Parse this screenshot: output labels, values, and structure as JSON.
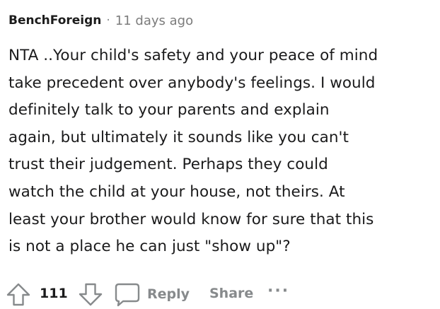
{
  "comment": {
    "author": "BenchForeign",
    "separator": "·",
    "timestamp": "11 days ago",
    "body": "NTA ..Your child's safety and your peace of mind\ntake precedent over anybody's feelings. I would\ndefinitely talk to your parents and explain\nagain, but ultimately it sounds like you can't\ntrust their judgement. Perhaps they could\nwatch the child at your house, not theirs. At\nleast your brother would know for sure that this\nis not a place he can just \"show up\"?"
  },
  "actions": {
    "score": "111",
    "reply_label": "Reply",
    "share_label": "Share",
    "more_label": "···",
    "upvote_icon": "upvote-arrow-icon",
    "downvote_icon": "downvote-arrow-icon",
    "reply_icon": "speech-bubble-icon"
  },
  "colors": {
    "text": "#1a1a1b",
    "muted": "#878a8c",
    "background": "#ffffff"
  }
}
